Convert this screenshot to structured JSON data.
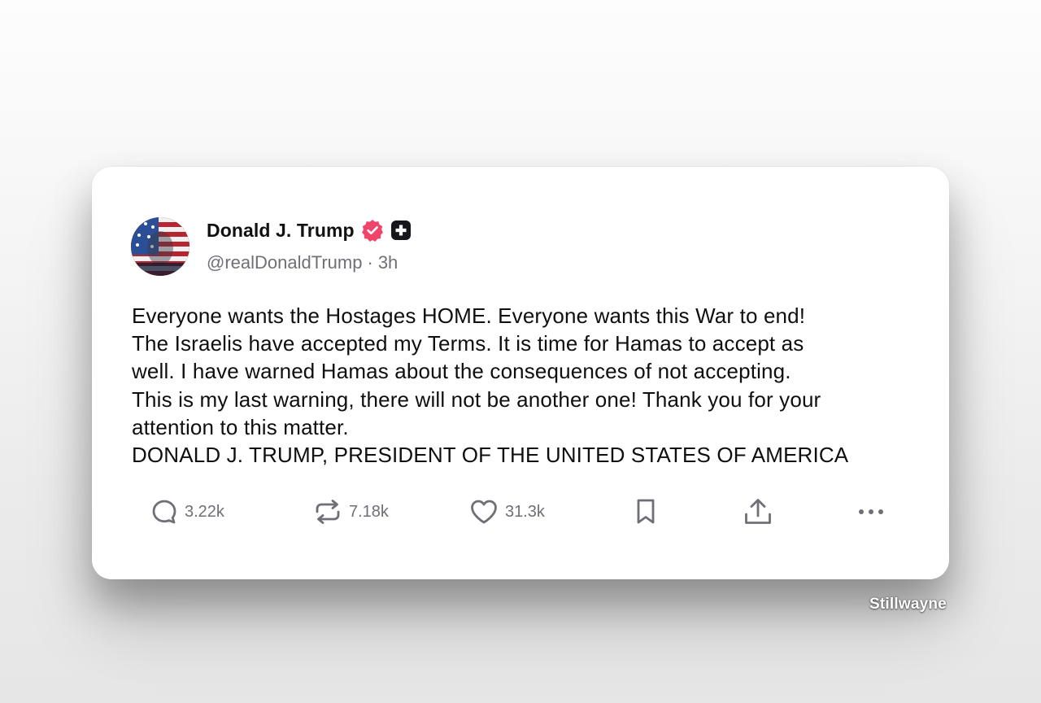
{
  "post": {
    "author": {
      "display_name": "Donald J. Trump",
      "handle": "@realDonaldTrump",
      "verified_icon": "verified-badge-icon",
      "plus_icon": "plus-badge-icon"
    },
    "separator": "·",
    "timestamp": "3h",
    "body_lines": [
      "Everyone wants the Hostages HOME. Everyone wants this War to end!",
      "The Israelis have accepted my Terms. It is time for Hamas to accept as",
      "well. I have warned Hamas about the consequences of not accepting.",
      "This is my last warning, there will not be another one! Thank you for your",
      "attention to this matter.",
      "DONALD J. TRUMP, PRESIDENT OF THE UNITED STATES OF AMERICA"
    ],
    "stats": {
      "replies": "3.22k",
      "reposts": "7.18k",
      "likes": "31.3k"
    },
    "actions": {
      "reply_icon": "reply-icon",
      "repost_icon": "repost-icon",
      "like_icon": "heart-icon",
      "bookmark_icon": "bookmark-icon",
      "share_icon": "share-icon",
      "more_icon": "more-icon"
    }
  },
  "watermark": "Stillwayne",
  "colors": {
    "verified_badge": "#f0456b",
    "plus_badge": "#16161c",
    "text_primary": "#111111",
    "text_secondary": "#6f6f78",
    "icon_gray": "#6f6f78"
  }
}
